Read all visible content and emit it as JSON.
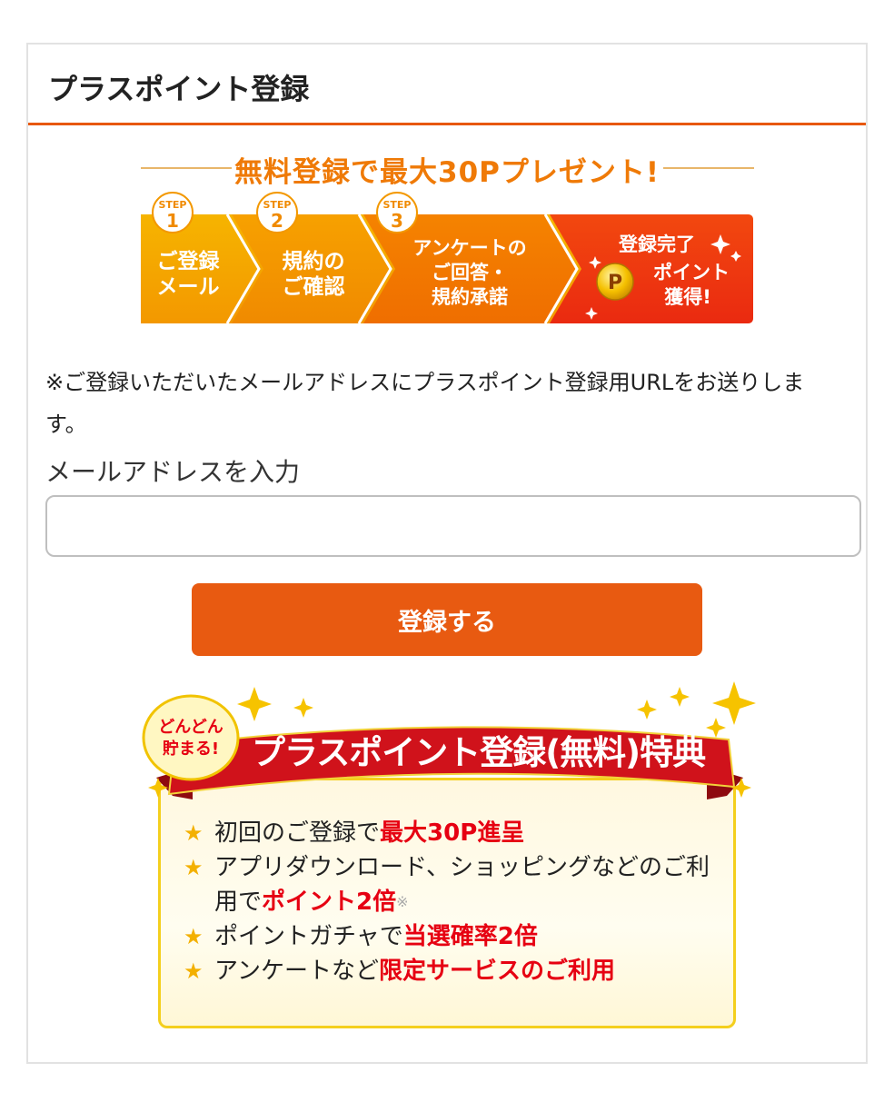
{
  "page": {
    "title": "プラスポイント登録"
  },
  "campaign": {
    "headline": "無料登録で最大30Pプレゼント!",
    "step_tag": "STEP",
    "steps": [
      {
        "number": "1",
        "lines": [
          "ご登録",
          "メール"
        ]
      },
      {
        "number": "2",
        "lines": [
          "規約の",
          "ご確認"
        ]
      },
      {
        "number": "3",
        "lines": [
          "アンケートの",
          "ご回答・",
          "規約承諾"
        ]
      }
    ],
    "final_step": {
      "lines": [
        "登録完了",
        "ポイント",
        "獲得!"
      ],
      "coin_letter": "P"
    }
  },
  "notice": "※ご登録いただいたメールアドレスにプラスポイント登録用URLをお送りします。",
  "form": {
    "email_label": "メールアドレスを入力",
    "email_value": "",
    "submit_label": "登録する"
  },
  "benefits": {
    "badge_lines": [
      "どんどん",
      "貯まる!"
    ],
    "title": "プラスポイント登録(無料)特典",
    "items": [
      {
        "text": "初回のご登録で",
        "highlight": "最大30P進呈",
        "mark": ""
      },
      {
        "text": "アプリダウンロード、ショッピングなどのご利用で",
        "highlight": "ポイント2倍",
        "mark": "※"
      },
      {
        "text": "ポイントガチャで",
        "highlight": "当選確率2倍",
        "mark": ""
      },
      {
        "text": "アンケートなど",
        "highlight": "限定サービスのご利用",
        "mark": ""
      }
    ]
  },
  "colors": {
    "accent": "#e85a11",
    "step_orange": "#f29a00",
    "final_red": "#f0300f",
    "banner_red": "#d0121b",
    "highlight_red": "#e60012",
    "box_border": "#f4cf1d"
  },
  "icons": {
    "list_bullet": "star-icon",
    "coin": "coin-p-icon",
    "sparkle": "sparkle-icon"
  }
}
